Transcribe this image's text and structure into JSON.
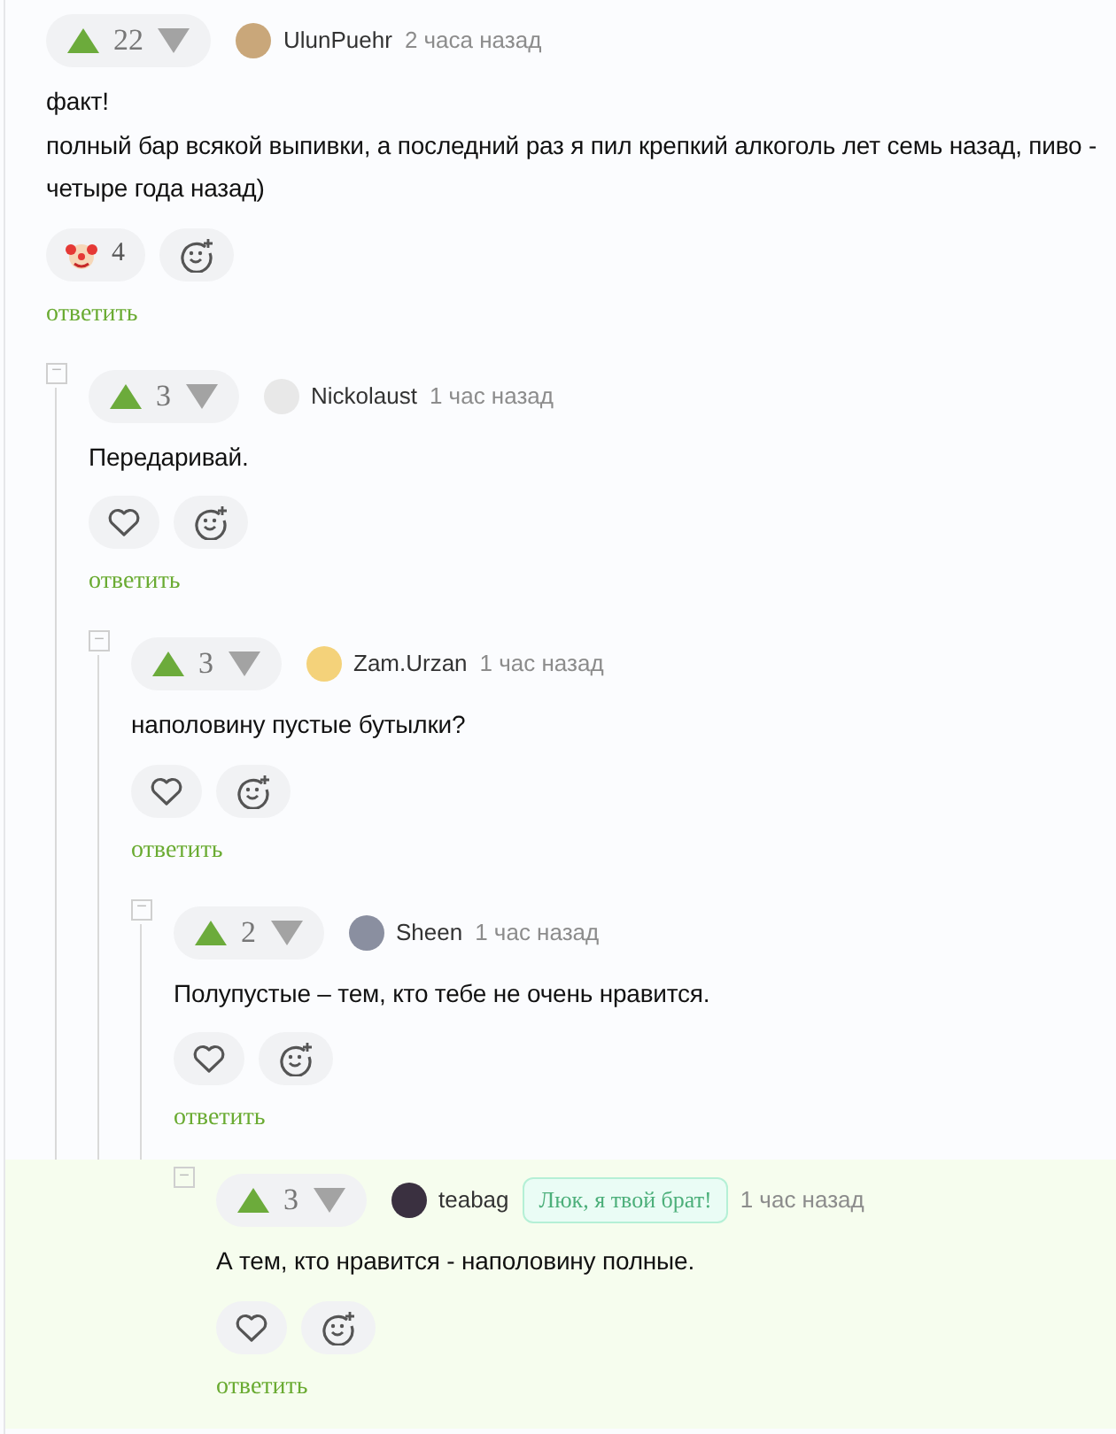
{
  "comments": [
    {
      "rating": "22",
      "author": "UlunPuehr",
      "time": "2 часа назад",
      "text": "факт!\nполный бар всякой выпивки, а последний раз я пил крепкий алкоголь лет семь назад, пиво - четыре года назад)",
      "reactions": [
        {
          "kind": "clown",
          "count": "4"
        }
      ],
      "reply": "ответить",
      "highlighted": false,
      "children": [
        {
          "rating": "3",
          "author": "Nickolaust",
          "time": "1 час назад",
          "text": "Передаривай.",
          "reactions": [
            {
              "kind": "like"
            }
          ],
          "reply": "ответить",
          "highlighted": false,
          "collapse": "−",
          "children": [
            {
              "rating": "3",
              "author": "Zam.Urzan",
              "time": "1 час назад",
              "text": "наполовину пустые бутылки?",
              "reactions": [
                {
                  "kind": "like"
                }
              ],
              "reply": "ответить",
              "highlighted": false,
              "collapse": "−",
              "children": [
                {
                  "rating": "2",
                  "author": "Sheen",
                  "time": "1 час назад",
                  "text": "Полупустые – тем, кто тебе не очень нравится.",
                  "reactions": [
                    {
                      "kind": "like"
                    }
                  ],
                  "reply": "ответить",
                  "highlighted": false,
                  "collapse": "−",
                  "children": [
                    {
                      "rating": "3",
                      "author": "teabag",
                      "badge": "Люк, я твой брат!",
                      "time": "1 час назад",
                      "text": "А тем, кто нравится - наполовину полные.",
                      "reactions": [
                        {
                          "kind": "like"
                        }
                      ],
                      "reply": "ответить",
                      "highlighted": true,
                      "collapse": "−"
                    }
                  ]
                }
              ]
            }
          ]
        }
      ]
    }
  ]
}
